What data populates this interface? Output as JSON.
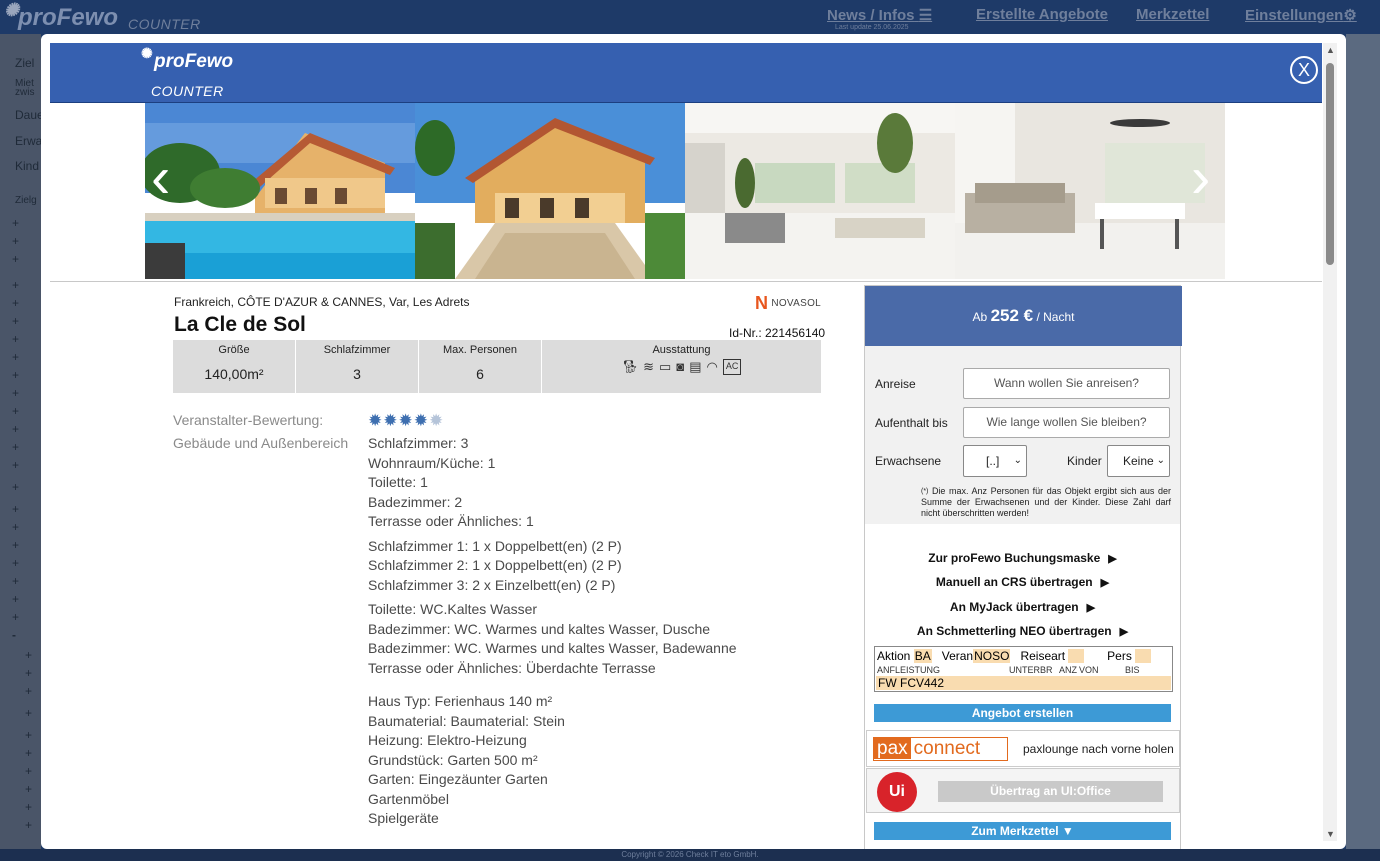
{
  "app": {
    "logo": "proFewo",
    "logo_sub": "COUNTER",
    "nav": {
      "news": "News / Infos",
      "news_sub": "Last update 25.06.2025",
      "offers": "Erstellte Angebote",
      "watchlist": "Merkzettel",
      "settings": "Einstellungen"
    },
    "left_labels": [
      "Ziel",
      "Miet",
      "zwis",
      "Daue",
      "Erwa",
      "Kind",
      "Zielg"
    ],
    "footer": "Copyright © 2026 Check IT eto GmbH."
  },
  "modal": {
    "logo": "proFewo",
    "logo_sub": "COUNTER",
    "close_label": "X",
    "prev_arrow": "‹",
    "next_arrow": "›",
    "breadcrumb": "Frankreich, CÔTE D'AZUR & CANNES, Var, Les Adrets",
    "provider": "NOVASOL",
    "provider_mark": "N",
    "title": "La Cle de Sol",
    "id": "Id-Nr.: 221456140",
    "facts": {
      "size_label": "Größe",
      "size_value": "140,00m²",
      "bedrooms_label": "Schlafzimmer",
      "bedrooms_value": "3",
      "maxpers_label": "Max. Personen",
      "maxpers_value": "6",
      "amenities_label": "Ausstattung",
      "amenities": [
        "dog-icon",
        "pool-icon",
        "tv-icon",
        "washer-icon",
        "dishwasher-icon",
        "wifi-icon",
        "ac-icon"
      ]
    },
    "rating_label": "Veranstalter-Bewertung:",
    "rating": 4,
    "rating_max": 5,
    "section_label": "Gebäude und Außenbereich",
    "details": {
      "rooms": [
        "Schlafzimmer: 3",
        "Wohnraum/Küche: 1",
        "Toilette: 1",
        "Badezimmer: 2",
        "Terrasse oder Ähnliches: 1"
      ],
      "beds": [
        "Schlafzimmer 1: 1 x Doppelbett(en) (2 P)",
        "Schlafzimmer 2: 1 x Doppelbett(en) (2 P)",
        "Schlafzimmer 3: 2 x Einzelbett(en) (2 P)"
      ],
      "sanitary": [
        "Toilette: WC.Kaltes Wasser",
        "Badezimmer: WC. Warmes und kaltes Wasser, Dusche",
        "Badezimmer: WC. Warmes und kaltes Wasser, Badewanne",
        "Terrasse oder Ähnliches: Überdachte Terrasse"
      ],
      "house": [
        "Haus Typ: Ferienhaus 140 m²",
        "Baumaterial: Baumaterial: Stein",
        "Heizung: Elektro-Heizung",
        "Grundstück: Garten 500 m²",
        "Garten: Eingezäunter Garten",
        "Gartenmöbel",
        "Spielgeräte"
      ]
    }
  },
  "booking": {
    "price_prefix": "Ab",
    "price": "252 €",
    "price_suffix": "/ Nacht",
    "arrival_label": "Anreise",
    "arrival_placeholder": "Wann wollen Sie anreisen?",
    "stay_label": "Aufenthalt bis",
    "stay_placeholder": "Wie lange wollen Sie bleiben?",
    "adults_label": "Erwachsene",
    "adults_value": "[..]",
    "children_label": "Kinder",
    "children_value": "Keine",
    "note_mark": "(*)",
    "note": "Die max. Anz Personen für das Objekt ergibt sich aus der Summe der Erwachsenen und der Kinder. Diese Zahl darf nicht überschritten werden!",
    "actions": [
      "Zur proFewo Buchungsmaske",
      "Manuell an CRS übertragen",
      "An MyJack übertragen",
      "An Schmetterling NEO übertragen"
    ],
    "crs": {
      "aktion_label": "Aktion",
      "aktion_value": "BA",
      "veran_label": "Veran",
      "veran_value": "NOSO",
      "reiseart_label": "Reiseart",
      "pers_label": "Pers",
      "headers": [
        "ANFLEISTUNG",
        "UNTERBR",
        "ANZ",
        "VON",
        "BIS"
      ],
      "leistung": "FW FCV442"
    },
    "create_offer": "Angebot erstellen",
    "pax_logo_a": "pax",
    "pax_logo_b": "connect",
    "pax_text": "paxlounge nach vorne holen",
    "ui_logo": "Ui",
    "ui_btn": "Übertrag an UI:Office",
    "watchlist_btn": "Zum Merkzettel ▼"
  },
  "colors": {
    "header_blue": "#3660b0",
    "price_blue": "#4a6aa8",
    "action_blue": "#3d9ad6",
    "highlight": "#f9dcb0",
    "star_on": "#3e6fb0"
  }
}
